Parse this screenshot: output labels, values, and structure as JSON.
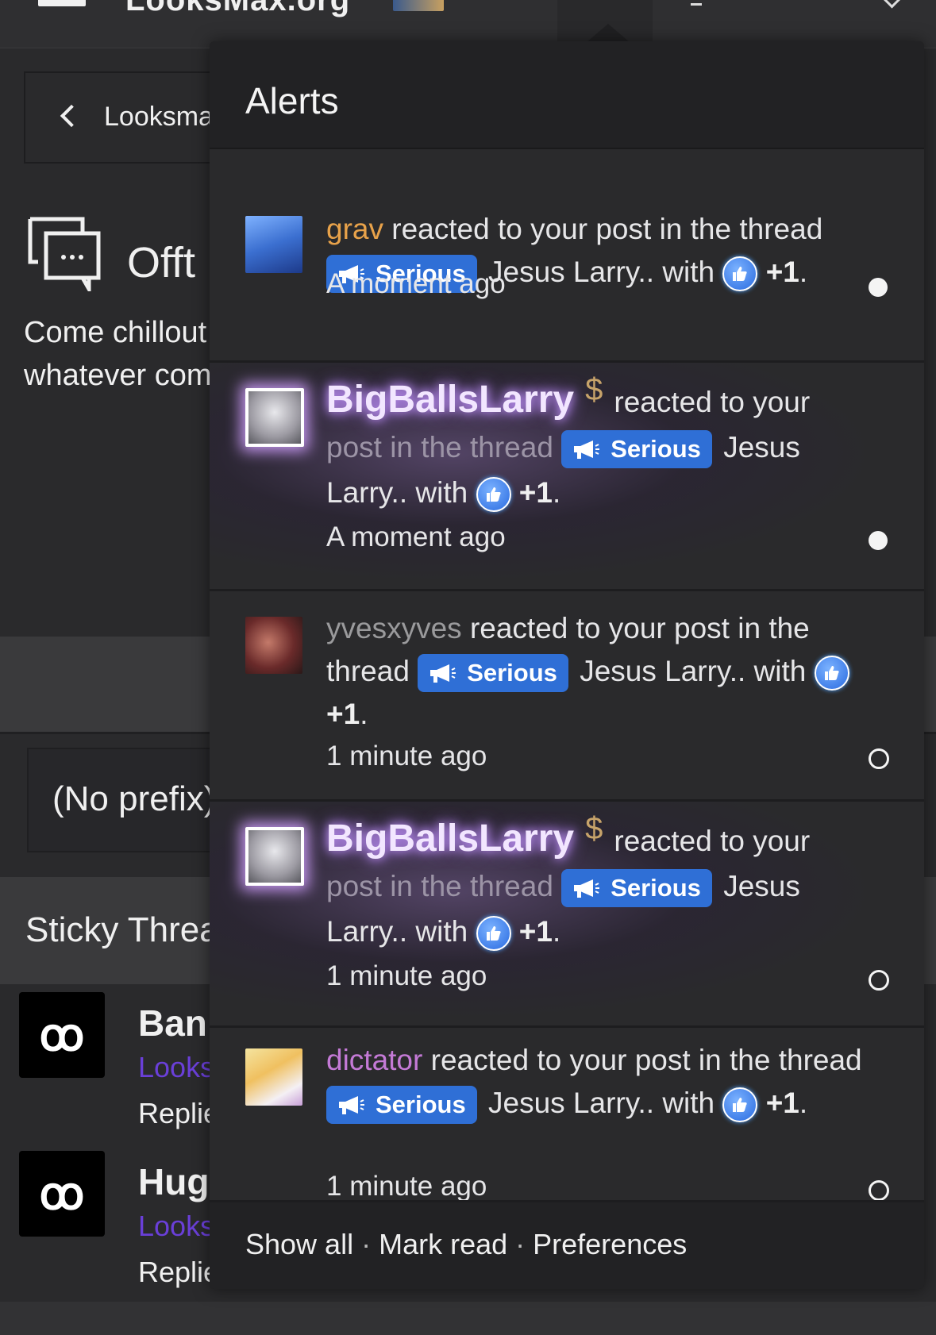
{
  "header": {
    "site_title": "LooksMax.org"
  },
  "page": {
    "back_label": "Looksma",
    "forum_title": "Offt",
    "forum_description": "Come chillout\nwhatever com",
    "prefix_filter": "(No prefix)",
    "sticky_label": "Sticky Threa",
    "threads": [
      {
        "title": "Ban",
        "forum": "Looks",
        "meta": "Replie"
      },
      {
        "title": "Hug",
        "forum": "Looks",
        "meta": "Replie"
      }
    ]
  },
  "alerts": {
    "title": "Alerts",
    "reacted_text": "reacted to your post in the thread",
    "reacted_text_part1": "reacted to your",
    "reacted_text_part2": "post in the thread",
    "prefix_badge": "Serious",
    "thread_title": "Jesus Larry..",
    "with_text": "with",
    "reaction_amount": "+1",
    "period": ".",
    "items": [
      {
        "username": "grav",
        "time": "A moment ago",
        "unread": true
      },
      {
        "username": "BigBallsLarry",
        "time": "A moment ago",
        "unread": true
      },
      {
        "username": "yvesxyves",
        "time": "1 minute ago",
        "unread": false
      },
      {
        "username": "BigBallsLarry",
        "time": "1 minute ago",
        "unread": false
      },
      {
        "username": "dictator",
        "time": "1 minute ago",
        "unread": false
      }
    ],
    "footer": {
      "show_all": "Show all",
      "mark_read": "Mark read",
      "preferences": "Preferences",
      "separator": "·"
    }
  },
  "icons": {
    "like": "thumbs-up-icon",
    "megaphone": "megaphone-icon",
    "dollar": "dollar-icon"
  },
  "colors": {
    "badge": "#2f6fd6",
    "grav": "#e8a24a",
    "dictator": "#c47ad6",
    "glow": "#c99bff"
  }
}
